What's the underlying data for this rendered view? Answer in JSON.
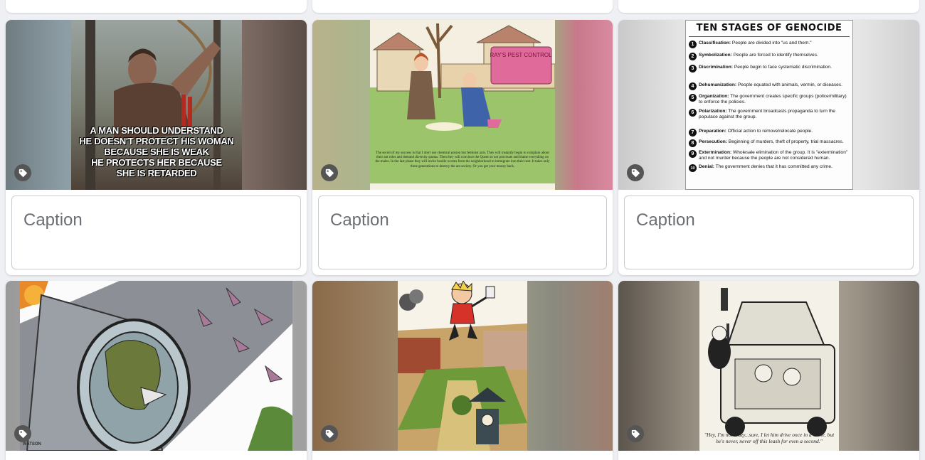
{
  "cards": [
    {
      "caption_placeholder": "Caption",
      "meme_lines": [
        "A MAN SHOULD UNDERSTAND",
        "HE DOESN'T PROTECT HIS WOMAN",
        "BECAUSE SHE IS WEAK",
        "HE PROTECTS HER BECAUSE",
        "SHE IS RETARDED"
      ]
    },
    {
      "caption_placeholder": "Caption",
      "truck_sign": "RAY'S PEST CONTROL",
      "story": "The secret of my success is that I don't use chemical poison but feminist ants. They will instantly begin to complain about their ant roles and demand diversity quotas. Then they will convince the Queen to not procreate and blame everything on the males. In the last phase they will invite hostile worms from the neighborhood to immigrate into their nest. It takes only three generations to destroy the ant society. Or you get your money back."
    },
    {
      "caption_placeholder": "Caption",
      "title": "TEN STAGES OF GENOCIDE",
      "stages": [
        {
          "n": "1",
          "name": "Classification:",
          "text": "People are divided into \"us and them.\""
        },
        {
          "n": "2",
          "name": "Symbolization:",
          "text": "People are forced to identify themselves."
        },
        {
          "n": "3",
          "name": "Discrimination:",
          "text": "People begin to face systematic discrimination."
        },
        {
          "n": "4",
          "name": "Dehumanization:",
          "text": "People equated with animals, vermin, or diseases."
        },
        {
          "n": "5",
          "name": "Organization:",
          "text": "The government creates specific groups (police/military) to enforce the policies."
        },
        {
          "n": "6",
          "name": "Polarization:",
          "text": "The government broadcasts propaganda to turn the populace against the group."
        },
        {
          "n": "7",
          "name": "Preparation:",
          "text": "Official action to remove/relocate people."
        },
        {
          "n": "8",
          "name": "Persecution:",
          "text": "Beginning of murders, theft of property, trial massacres."
        },
        {
          "n": "9",
          "name": "Extermination:",
          "text": "Wholesale elimination of the group. It is \"extermination\" and not murder because the people are not considered human."
        },
        {
          "n": "10",
          "name": "Denial:",
          "text": "The government denies that it has committed any crime."
        }
      ]
    },
    {
      "signature": "WATSON"
    },
    {},
    {
      "caption_text": "\"Hey, I'm not crazy...sure, I let him drive once in a while, but he's never, never off this leash for even a second.\""
    }
  ],
  "colors": {
    "page_bg": "#eef0f3",
    "card_bg": "#ffffff",
    "tag_button": "#555555"
  },
  "icons": {
    "tag": "tag-icon"
  }
}
